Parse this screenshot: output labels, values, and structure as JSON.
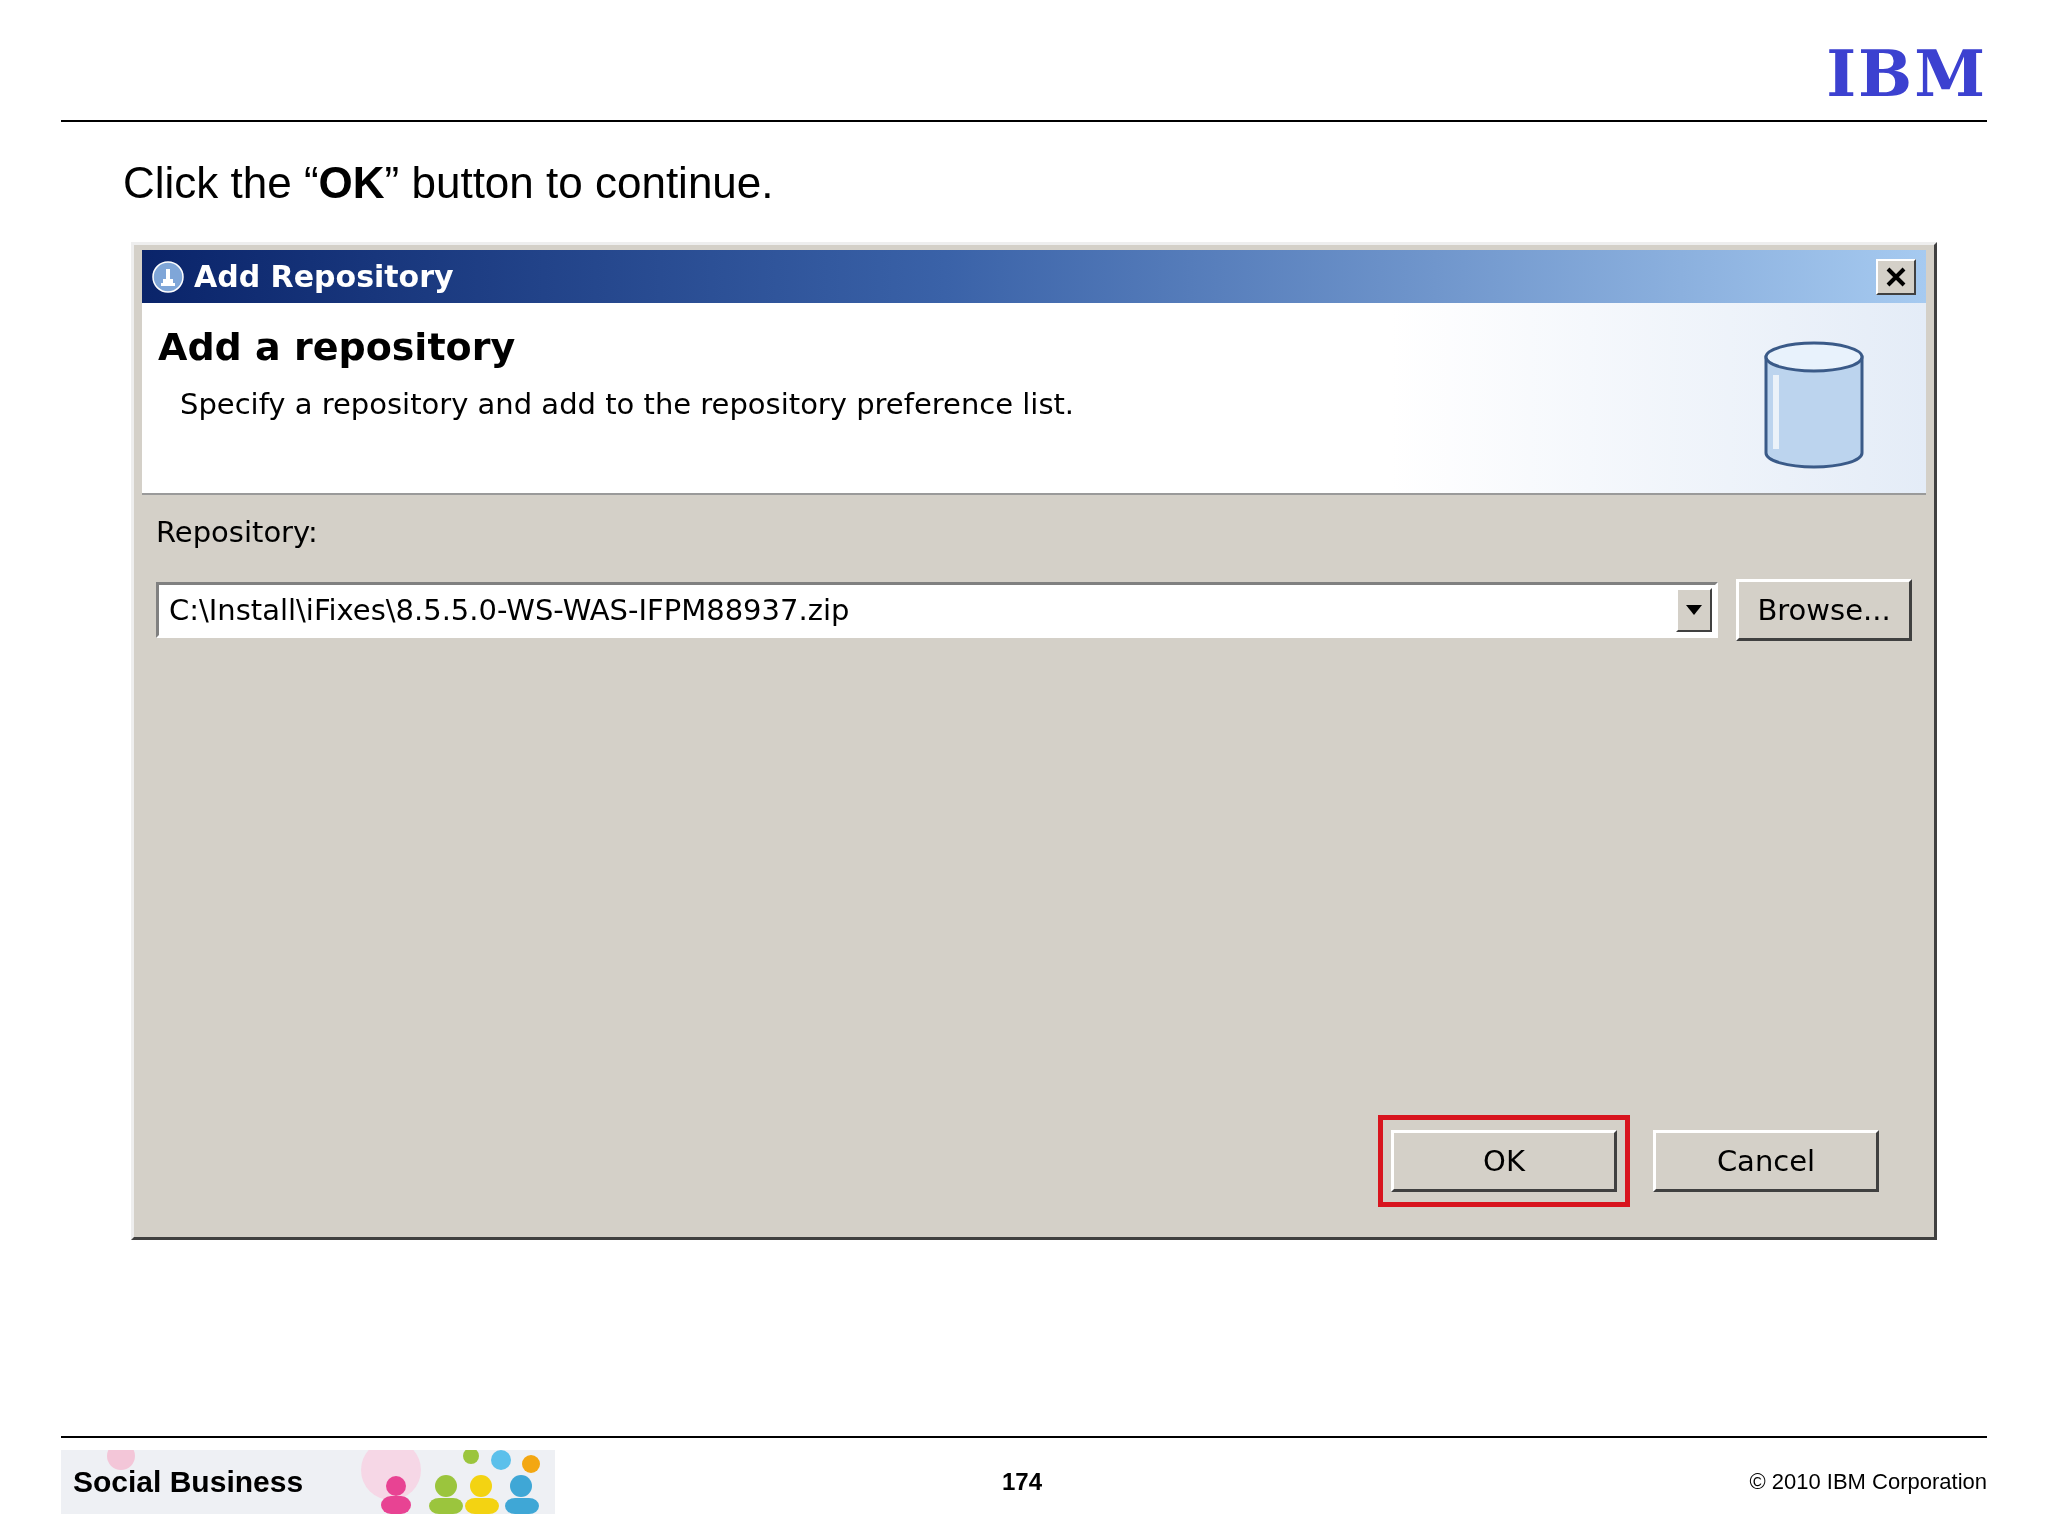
{
  "slide": {
    "logo": "IBM",
    "instruction": "Click the “**OK**” button to continue."
  },
  "dialog": {
    "title": "Add Repository",
    "heading": "Add a repository",
    "description": "Specify a repository and add to the repository preference list.",
    "field_label": "Repository:",
    "repository": {
      "value": "C:\\Install\\iFixes\\8.5.5.0-WS-WAS-IFPM88937.zip"
    },
    "browse": "Browse...",
    "buttons": [
      {
        "label": "OK",
        "highlighted": true
      },
      {
        "label": "Cancel",
        "highlighted": false
      }
    ]
  },
  "footer": {
    "brand": "Social Business",
    "page": "174",
    "copyright": "© 2010 IBM Corporation"
  }
}
